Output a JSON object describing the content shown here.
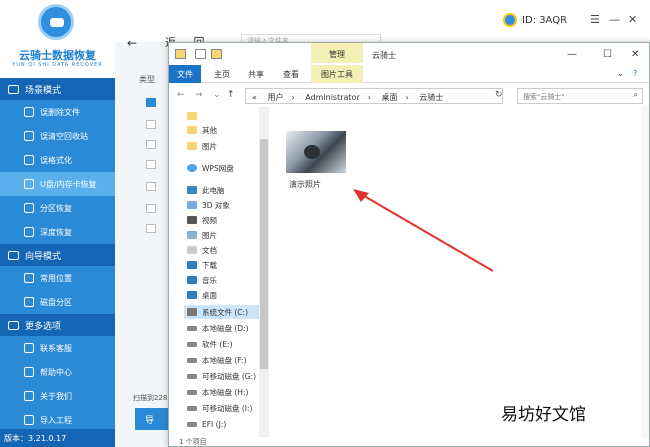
{
  "app": {
    "logo_title": "云骑士数据恢复",
    "logo_sub": "YUN QI SHI DATA RECOVER",
    "version": "版本：3.21.0.17",
    "user_id": "ID: 3AQR",
    "sections": [
      {
        "title": "场景模式",
        "items": [
          "误删除文件",
          "误清空回收站",
          "误格式化",
          "U盘/内存卡恢复",
          "分区恢复",
          "深度恢复"
        ]
      },
      {
        "title": "向导模式",
        "items": [
          "常用位置",
          "磁盘分区"
        ]
      },
      {
        "title": "更多选项",
        "items": [
          "联系客服",
          "帮助中心",
          "关于我们",
          "导入工程"
        ]
      }
    ],
    "active_item": "U盘/内存卡恢复",
    "back_label": "返",
    "type_col": "类型",
    "scan_text": "扫描到228",
    "start_btn": "导",
    "search_hint": "请输入文件名"
  },
  "explorer": {
    "folder_name": "云骑士",
    "manage_tab": "管理",
    "ribbon_tabs": [
      "文件",
      "主页",
      "共享",
      "查看",
      "图片工具"
    ],
    "path": [
      "用户",
      "Administrator",
      "桌面",
      "云骑士"
    ],
    "search_placeholder": "搜索\"云骑士\"",
    "nav_items": [
      "其他",
      "图片",
      "WPS网盘",
      "此电脑",
      "3D 对象",
      "视频",
      "图片",
      "文档",
      "下载",
      "音乐",
      "桌面",
      "系统文件 (C:)",
      "本地磁盘 (D:)",
      "软件 (E:)",
      "本地磁盘 (F:)",
      "可移动磁盘 (G:)",
      "本地磁盘 (H:)",
      "可移动磁盘 (I:)",
      "EFI (J:)"
    ],
    "selected_nav": "系统文件 (C:)",
    "file_label": "演示照片",
    "status": "1 个项目"
  },
  "watermark": "易坊好文馆"
}
